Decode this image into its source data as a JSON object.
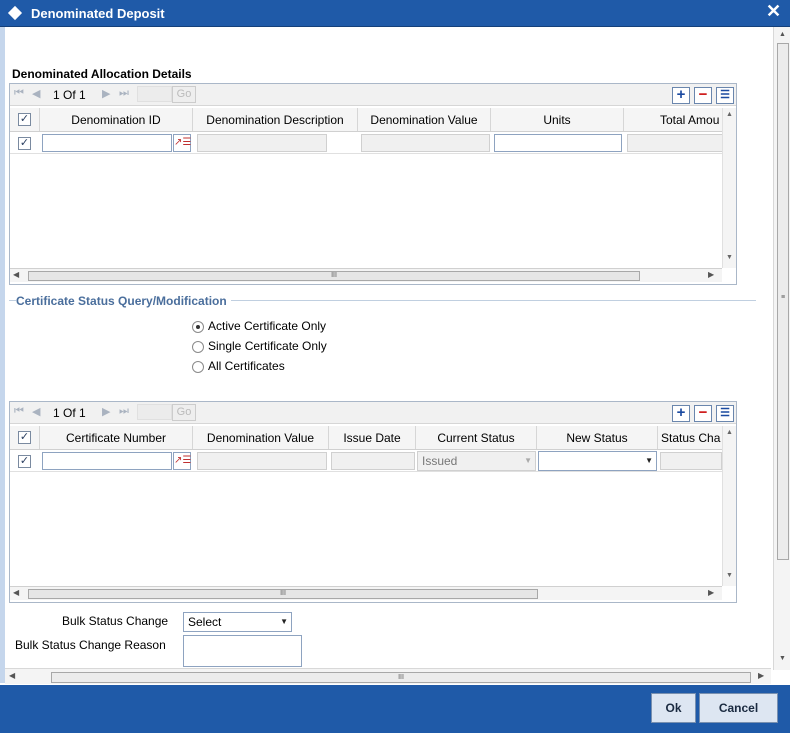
{
  "window": {
    "title": "Denominated Deposit"
  },
  "allocation": {
    "section_title": "Denominated Allocation Details",
    "pager": "1 Of 1",
    "go_label": "Go",
    "columns": [
      "Denomination ID",
      "Denomination Description",
      "Denomination Value",
      "Units",
      "Total Amou"
    ]
  },
  "certificate": {
    "legend": "Certificate Status Query/Modification",
    "radios": [
      {
        "label": "Active Certificate Only",
        "selected": true
      },
      {
        "label": "Single Certificate Only",
        "selected": false
      },
      {
        "label": "All Certificates",
        "selected": false
      }
    ],
    "pager": "1 Of 1",
    "go_label": "Go",
    "columns": [
      "Certificate Number",
      "Denomination Value",
      "Issue Date",
      "Current Status",
      "New Status",
      "Status Cha"
    ],
    "row": {
      "current_status": "Issued",
      "new_status": ""
    }
  },
  "bulk": {
    "status_change_label": "Bulk Status Change",
    "status_change_value": "Select",
    "reason_label": "Bulk Status Change Reason"
  },
  "buttons": {
    "ok": "Ok",
    "cancel": "Cancel"
  },
  "icons": {
    "title_icon": "diamond-icon",
    "close": "close-icon",
    "add": "add-row-icon",
    "delete": "delete-row-icon",
    "view": "single-view-icon",
    "lov": "list-of-values-icon"
  },
  "colors": {
    "titlebar": "#1f5aa8",
    "legend": "#4a6e9c",
    "grid_border": "#aab7c8"
  }
}
